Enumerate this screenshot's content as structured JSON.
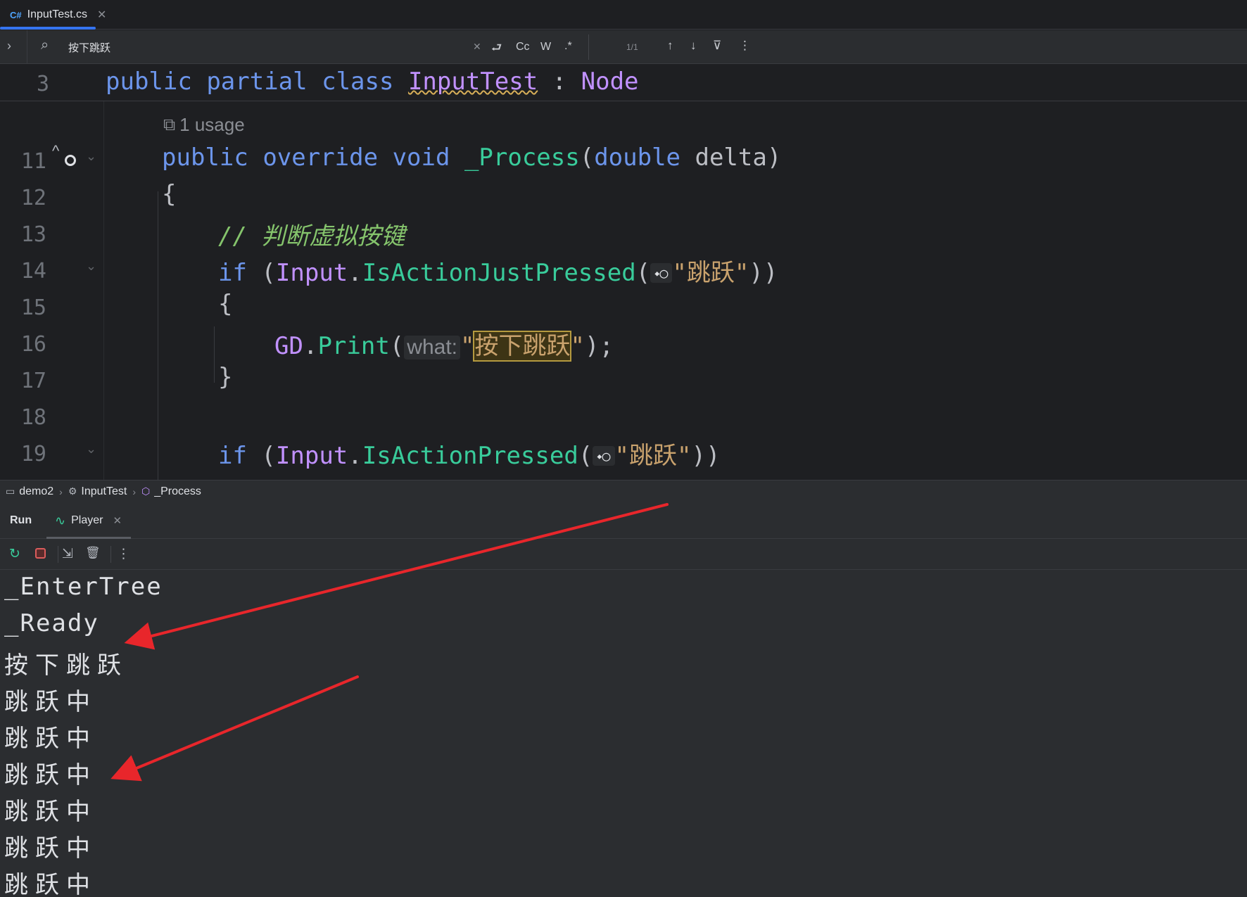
{
  "tab": {
    "lang_badge": "C#",
    "file_name": "InputTest.cs",
    "close": "✕"
  },
  "find": {
    "query": "按下跳跃",
    "clear": "✕",
    "wrap": "⮐",
    "match_case": "Cc",
    "whole_words": "W",
    "regex": ".*",
    "count": "1/1",
    "prev": "↑",
    "next": "↓",
    "filter": "⊽",
    "more": "⋮"
  },
  "editor": {
    "sticky": {
      "line": "3",
      "tokens": [
        "public",
        "partial",
        "class",
        "InputTest",
        ":",
        "Node"
      ]
    },
    "usage": "1 usage",
    "lines": [
      {
        "n": "11",
        "kw1": "public",
        "kw2": "override",
        "kw3": "void",
        "fn": "_Process",
        "p1": "(",
        "type": "double",
        "param": " delta",
        "p2": ")"
      },
      {
        "n": "12",
        "text": "{"
      },
      {
        "n": "13",
        "comment": "// 判断虚拟按键"
      },
      {
        "n": "14",
        "kw": "if",
        "open": " (",
        "cls": "Input",
        "dot": ".",
        "fn": "IsActionJustPressed",
        "p": "(",
        "str": "\"跳跃\"",
        "close": "))"
      },
      {
        "n": "15",
        "text": "{"
      },
      {
        "n": "16",
        "cls": "GD",
        "dot": ".",
        "fn": "Print",
        "p": "(",
        "hint": "what:",
        "q1": "\"",
        "str": "按下跳跃",
        "q2": "\"",
        "end": ");"
      },
      {
        "n": "17",
        "text": "}"
      },
      {
        "n": "18"
      },
      {
        "n": "19",
        "kw": "if",
        "open": " (",
        "cls": "Input",
        "dot": ".",
        "fn": "IsActionPressed",
        "p": "(",
        "str": "\"跳跃\"",
        "close": "))"
      }
    ]
  },
  "breadcrumb": {
    "project": "demo2",
    "class": "InputTest",
    "method": "_Process",
    "sep": "›"
  },
  "run": {
    "title": "Run",
    "tab": "Player",
    "close": "✕"
  },
  "toolbar": {
    "rerun": "↻",
    "scroll": "⇲",
    "clear": "🗑",
    "more": "⋮"
  },
  "console": [
    "_EnterTree",
    "_Ready",
    "按下跳跃",
    "跳跃中",
    "跳跃中",
    "跳跃中",
    "跳跃中",
    "跳跃中",
    "跳跃中"
  ],
  "colors": {
    "annotation_arrow": "#e8262b",
    "keyword": "#6c95eb",
    "class": "#c191ff",
    "method": "#39cc9b",
    "string": "#c9a26d",
    "comment": "#85c46c"
  }
}
